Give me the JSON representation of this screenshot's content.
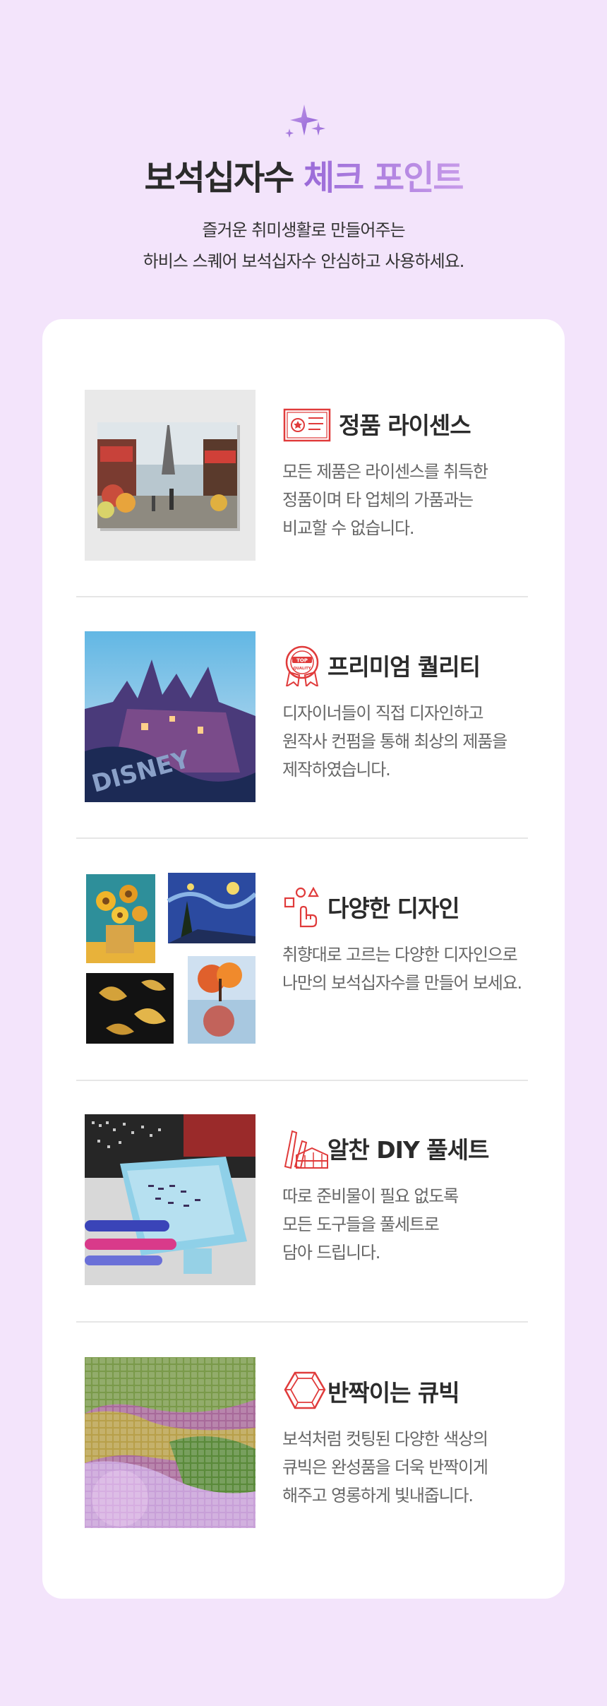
{
  "header": {
    "title_main": "보석십자수",
    "title_accent": "체크 포인트",
    "subtitle_line1": "즐거운 취미생활로 만들어주는",
    "subtitle_line2": "하비스 스퀘어 보석십자수 안심하고 사용하세요."
  },
  "colors": {
    "background": "#f3e4fb",
    "accent": "#a77add",
    "icon_red": "#e03b3b"
  },
  "items": [
    {
      "icon": "license-certificate-icon",
      "title": "정품 라이센스",
      "desc": [
        "모든 제품은 라이센스를 취득한",
        "정품이며 타 업체의 가품과는",
        "비교할 수 없습니다."
      ],
      "image": "paris-street-eiffel-tower-canvas"
    },
    {
      "icon": "top-quality-badge-icon",
      "title": "프리미엄 퀄리티",
      "badge_top": "TOP",
      "badge_bottom": "QUALITY",
      "desc": [
        "디자이너들이 직접 디자인하고",
        "원작사 컨펌을 통해 최상의 제품을",
        "제작하였습니다."
      ],
      "image": "disney-castle-diamond-painting"
    },
    {
      "icon": "hand-pointer-options-icon",
      "title": "다양한 디자인",
      "desc": [
        "취향대로 고르는 다양한 디자인으로",
        "나만의 보석십자수를 만들어 보세요."
      ],
      "image": "collage-sunflowers-starry-night-koi-tree"
    },
    {
      "icon": "diy-tools-icon",
      "title": "알찬 DIY 풀세트",
      "desc": [
        "따로 준비물이 필요 없도록",
        "모든 도구들을 풀세트로",
        "담아 드립니다."
      ],
      "image": "diamond-painting-tools-set"
    },
    {
      "icon": "gem-cubic-icon",
      "title": "반짝이는 큐빅",
      "desc": [
        "보석처럼 컷팅된 다양한 색상의",
        "큐빅은 완성품을 더욱 반짝이게",
        "해주고 영롱하게 빛내줍니다."
      ],
      "image": "sparkling-diamond-beads-closeup"
    }
  ]
}
